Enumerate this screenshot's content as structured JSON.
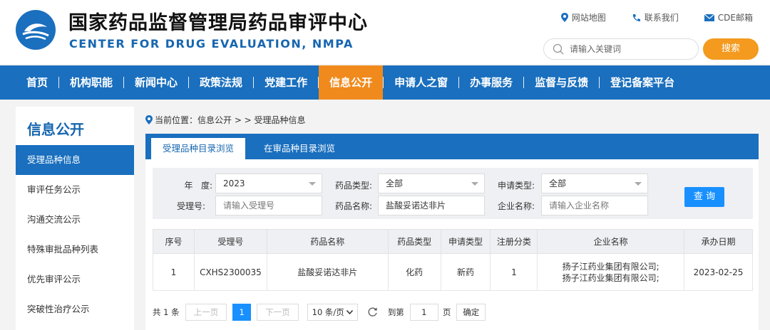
{
  "header": {
    "title_cn": "国家药品监督管理局药品审评中心",
    "title_en": "CENTER FOR DRUG EVALUATION, NMPA",
    "links": [
      {
        "label": "网站地图",
        "icon": "location-pin-icon"
      },
      {
        "label": "联系我们",
        "icon": "phone-icon"
      },
      {
        "label": "CDE邮箱",
        "icon": "mail-icon"
      }
    ],
    "search_placeholder": "请输入关键词",
    "search_button": "搜索"
  },
  "nav": {
    "items": [
      "首页",
      "机构职能",
      "新闻中心",
      "政策法规",
      "党建工作",
      "信息公开",
      "申请人之窗",
      "办事服务",
      "监督与反馈",
      "登记备案平台"
    ],
    "active": "信息公开"
  },
  "sidebar": {
    "title": "信息公开",
    "items": [
      "受理品种信息",
      "审评任务公示",
      "沟通交流公示",
      "特殊审批品种列表",
      "优先审评公示",
      "突破性治疗公示"
    ],
    "active": "受理品种信息"
  },
  "breadcrumb": "当前位置：信息公开 > > 受理品种信息",
  "tabs": [
    "受理品种目录浏览",
    "在审品种目录浏览"
  ],
  "filters": {
    "year_label": "年   度:",
    "year_value": "2023",
    "drug_type_label": "药品类型:",
    "drug_type_value": "全部",
    "apply_type_label": "申请类型:",
    "apply_type_value": "全部",
    "accept_no_label": "受理号:",
    "accept_no_placeholder": "请输入受理号",
    "drug_name_label": "药品名称:",
    "drug_name_value": "盐酸妥诺达非片",
    "company_label": "企业名称:",
    "company_placeholder": "请输入企业名称",
    "query_button": "查 询"
  },
  "table": {
    "headers": [
      "序号",
      "受理号",
      "药品名称",
      "药品类型",
      "申请类型",
      "注册分类",
      "企业名称",
      "承办日期"
    ],
    "rows": [
      {
        "index": "1",
        "accept_no": "CXHS2300035",
        "drug_name": "盐酸妥诺达非片",
        "drug_type": "化药",
        "apply_type": "新药",
        "reg_class": "1",
        "company_line1": "扬子江药业集团有限公司;",
        "company_line2": "扬子江药业集团有限公司;",
        "date": "2023-02-25"
      }
    ]
  },
  "pager": {
    "total": "共 1 条",
    "prev": "上一页",
    "current": "1",
    "next": "下一页",
    "page_size": "10 条/页",
    "goto_prefix": "到第",
    "goto_value": "1",
    "goto_suffix": "页",
    "confirm": "确定"
  },
  "colors": {
    "brand_blue": "#1a6fbe",
    "accent_orange": "#f08a1c",
    "button_blue": "#1890ff"
  }
}
